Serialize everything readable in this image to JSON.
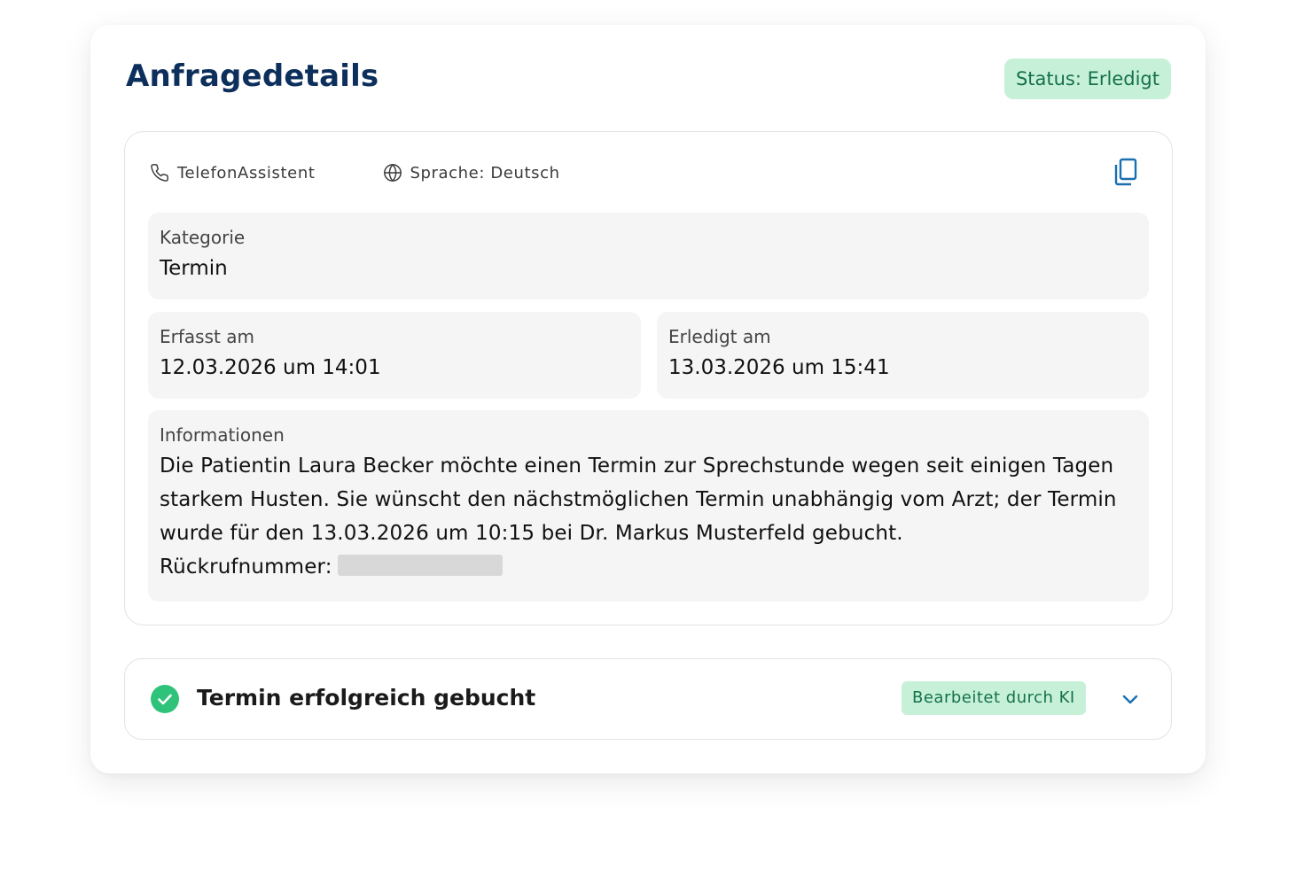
{
  "header": {
    "title": "Anfragedetails",
    "status": "Status: Erledigt"
  },
  "meta": {
    "channel": "TelefonAssistent",
    "language": "Sprache: Deutsch"
  },
  "fields": {
    "kategorie": {
      "label": "Kategorie",
      "value": "Termin"
    },
    "erfasst": {
      "label": "Erfasst am",
      "value": "12.03.2026 um 14:01"
    },
    "erledigt": {
      "label": "Erledigt am",
      "value": "13.03.2026 um 15:41"
    },
    "informationen": {
      "label": "Informationen",
      "text": "Die Patientin Laura Becker möchte einen Termin zur Sprechstunde wegen seit einigen Tagen starkem Husten. Sie wünscht den nächstmöglichen Termin unabhängig vom Arzt; der Termin wurde für den 13.03.2026 um 10:15 bei Dr. Markus Musterfeld gebucht.",
      "callback_label": "Rückrufnummer:"
    }
  },
  "result": {
    "title": "Termin erfolgreich gebucht",
    "badge": "Bearbeitet durch KI"
  },
  "colors": {
    "title": "#0d2f5c",
    "accent": "#1a6fb0",
    "badge_bg": "#c6f1d8",
    "badge_text": "#16704a",
    "success": "#2fc27a",
    "field_bg": "#f5f5f5"
  },
  "icons": {
    "channel": "phone-icon",
    "language": "globe-icon",
    "copy": "copy-icon",
    "success": "check-circle-icon",
    "expand": "chevron-down-icon"
  }
}
